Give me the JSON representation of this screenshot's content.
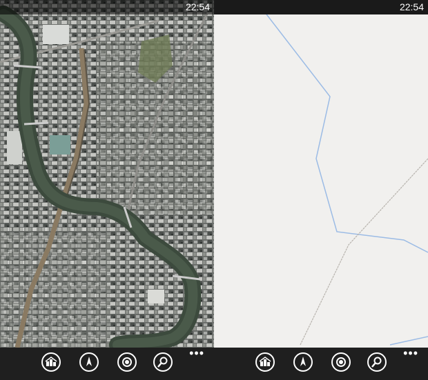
{
  "phones": [
    {
      "status_time": "22:54",
      "map_mode": "aerial",
      "appbar": {
        "buttons": [
          "directions-icon",
          "compass-icon",
          "location-icon",
          "search-icon"
        ],
        "more": "•••"
      }
    },
    {
      "status_time": "22:54",
      "map_mode": "road",
      "appbar": {
        "buttons": [
          "directions-icon",
          "compass-icon",
          "location-icon",
          "search-icon"
        ],
        "more": "•••"
      }
    }
  ],
  "colors": {
    "statusbar": "#1a1a1a",
    "appbar": "#1f1f1f",
    "road_map_bg": "#f1f0ee",
    "boundary_line": "#9bbbe5",
    "road_line": "#b7b3ad",
    "river": "#3c4a3d"
  }
}
